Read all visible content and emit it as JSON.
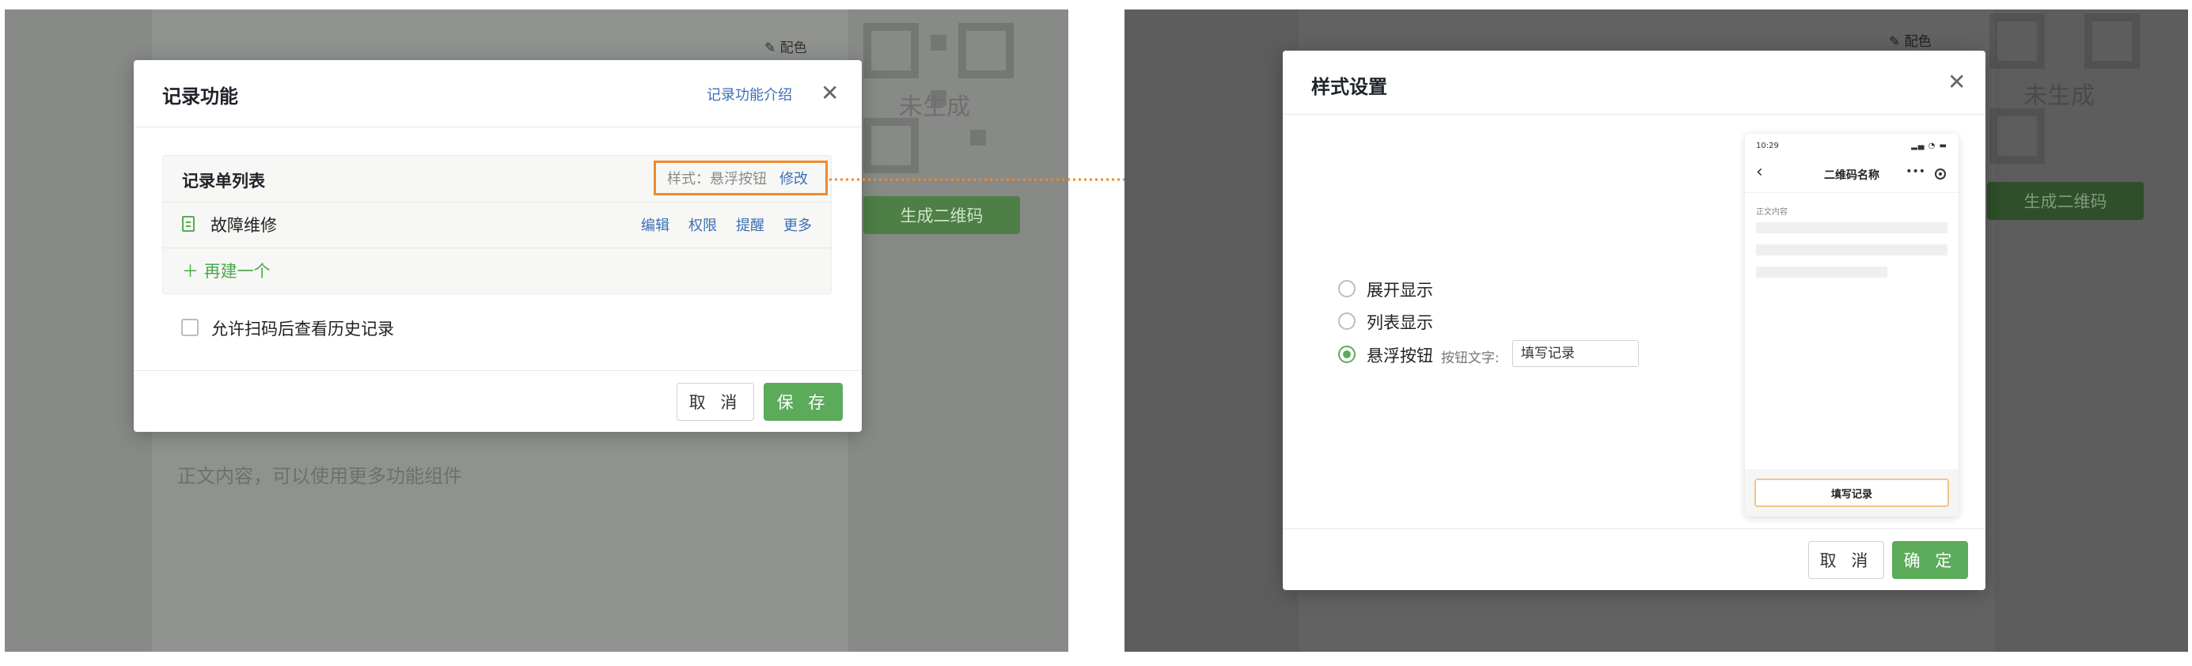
{
  "background_color": "#878a86",
  "left": {
    "peicolor_label": "配色",
    "qr_label": "未生成",
    "generate_button": "生成二维码",
    "body_placeholder": "正文内容，可以使用更多功能组件",
    "dialog": {
      "title": "记录功能",
      "intro_link": "记录功能介绍",
      "list_header": "记录单列表",
      "style_label": "样式：悬浮按钮",
      "style_edit": "修改",
      "item_name": "故障维修",
      "item_actions": [
        "编辑",
        "权限",
        "提醒",
        "更多"
      ],
      "add_new": "再建一个",
      "history_checkbox_label": "允许扫码后查看历史记录",
      "cancel_button": "取 消",
      "save_button": "保 存"
    }
  },
  "right": {
    "peicolor_label": "配色",
    "qr_label": "未生成",
    "generate_button": "生成二维码",
    "dialog": {
      "title": "样式设置",
      "options": [
        "展开显示",
        "列表显示",
        "悬浮按钮"
      ],
      "selected_option": "悬浮按钮",
      "button_text_label": "按钮文字:",
      "button_text_value": "填写记录",
      "cancel_button": "取 消",
      "confirm_button": "确 定"
    },
    "phone": {
      "time": "10:29",
      "title": "二维码名称",
      "body_label": "正文内容",
      "fill_button": "填写记录"
    }
  },
  "colors": {
    "accent_green": "#5cab5a",
    "link_blue": "#3b6fb6",
    "highlight_orange": "#ef8b2a"
  },
  "icons": [
    "close-icon",
    "document-icon",
    "plus-icon",
    "paint-icon",
    "back-icon",
    "more-icon",
    "target-icon"
  ]
}
